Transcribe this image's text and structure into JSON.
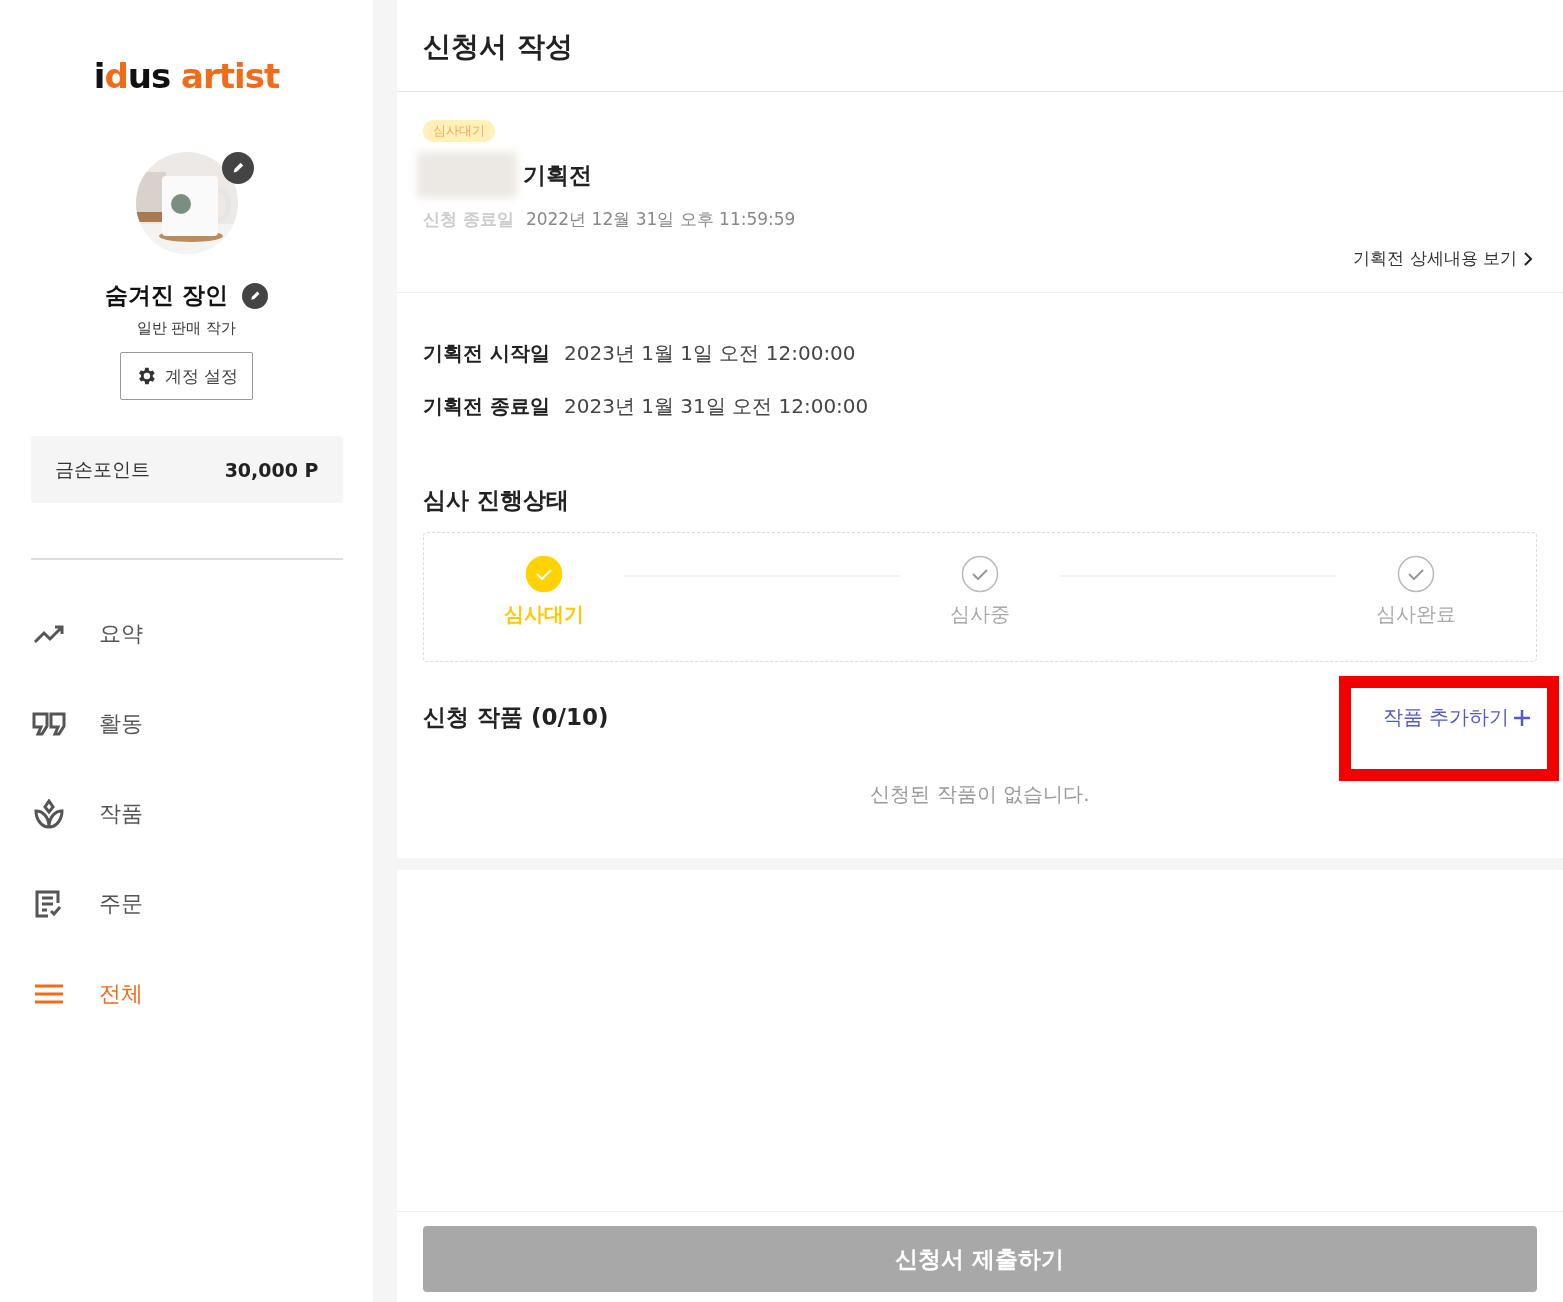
{
  "sidebar": {
    "logo": {
      "brand": "idus",
      "suffix": "artist"
    },
    "profile": {
      "name": "숨겨진 장인",
      "role": "일반 판매 작가",
      "settings_button": "계정 설정"
    },
    "points": {
      "label": "금손포인트",
      "value": "30,000 P"
    },
    "nav": [
      {
        "kind": "trend",
        "label": "요약",
        "selected": false
      },
      {
        "kind": "quote",
        "label": "활동",
        "selected": false
      },
      {
        "kind": "plant",
        "label": "작품",
        "selected": false
      },
      {
        "kind": "order",
        "label": "주문",
        "selected": false
      },
      {
        "kind": "menu",
        "label": "전체",
        "selected": true
      }
    ]
  },
  "page_title": "신청서 작성",
  "exhibition": {
    "badge": "심사대기",
    "title": "기획전",
    "deadline_label": "신청 종료일",
    "deadline": "2022년 12월 31일 오후 11:59:59",
    "detail_link": "기획전 상세내용 보기"
  },
  "dates": [
    {
      "label": "기획전 시작일",
      "value": "2023년 1월 1일 오전 12:00:00"
    },
    {
      "label": "기획전 종료일",
      "value": "2023년 1월 31일 오전 12:00:00"
    }
  ],
  "review": {
    "title": "심사 진행상태",
    "steps": [
      {
        "label": "심사대기",
        "selected": true
      },
      {
        "label": "심사중",
        "selected": false
      },
      {
        "label": "심사완료",
        "selected": false
      }
    ]
  },
  "works": {
    "title": "신청 작품 (0/10)",
    "add_button": "작품 추가하기",
    "empty": "신청된 작품이 없습니다."
  },
  "submit": {
    "label": "신청서 제출하기",
    "disabled": true
  }
}
